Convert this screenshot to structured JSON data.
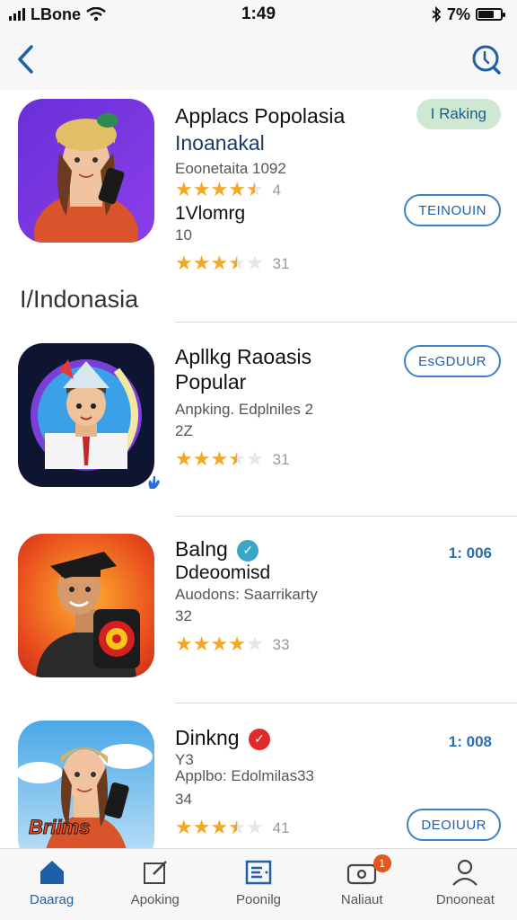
{
  "status_bar": {
    "carrier": "LBone",
    "time": "1:49",
    "battery": "7%",
    "battery_level": 0.7
  },
  "nav": {
    "back_icon": "chevron-left-icon",
    "search_icon": "search-icon"
  },
  "apps": [
    {
      "title": "Applacs Popolasia",
      "subtitle": "Inoanakal",
      "meta1": "Eoonetaita 1092",
      "stars": 4.5,
      "rating_count": "4",
      "extra_title": "1Vlomrg",
      "extra_meta": "10",
      "stars2": 3.5,
      "rating_count2": "31",
      "rank_label": "I Raking",
      "button": "TEINOUIN"
    },
    {
      "title": "Apllkg Raoasis",
      "subtitle": "Popular",
      "meta1": "Anpking. Edplniles 2",
      "meta2": "2Z",
      "stars": 3.5,
      "rating_count": "31",
      "button": "EsGDUUR"
    },
    {
      "title": "Balng",
      "subtitle": "Ddeoomisd",
      "meta1": "Auodons: Saarrikarty",
      "meta2": "32",
      "stars": 4,
      "rating_count": "33",
      "price": "1: 006"
    },
    {
      "title": "Dinkng",
      "subtitle": "Y3",
      "meta1": "Applbo: Edolmilas33",
      "meta2": "34",
      "stars": 3.5,
      "rating_count": "41",
      "price": "1: 008",
      "button": "DEOIUUR",
      "icon_caption": "Briims"
    }
  ],
  "section_title": "I/Indonasia",
  "tabs": [
    {
      "label": "Daarag",
      "icon": "home-icon"
    },
    {
      "label": "Apoking",
      "icon": "edit-icon"
    },
    {
      "label": "Poonilg",
      "icon": "list-icon"
    },
    {
      "label": "Naliaut",
      "icon": "camera-icon",
      "badge": "1"
    },
    {
      "label": "Dnooneat",
      "icon": "person-icon"
    }
  ],
  "colors": {
    "accent": "#1f5fa8",
    "star": "#f5a623",
    "rank_pill": "#cfe8d3"
  }
}
